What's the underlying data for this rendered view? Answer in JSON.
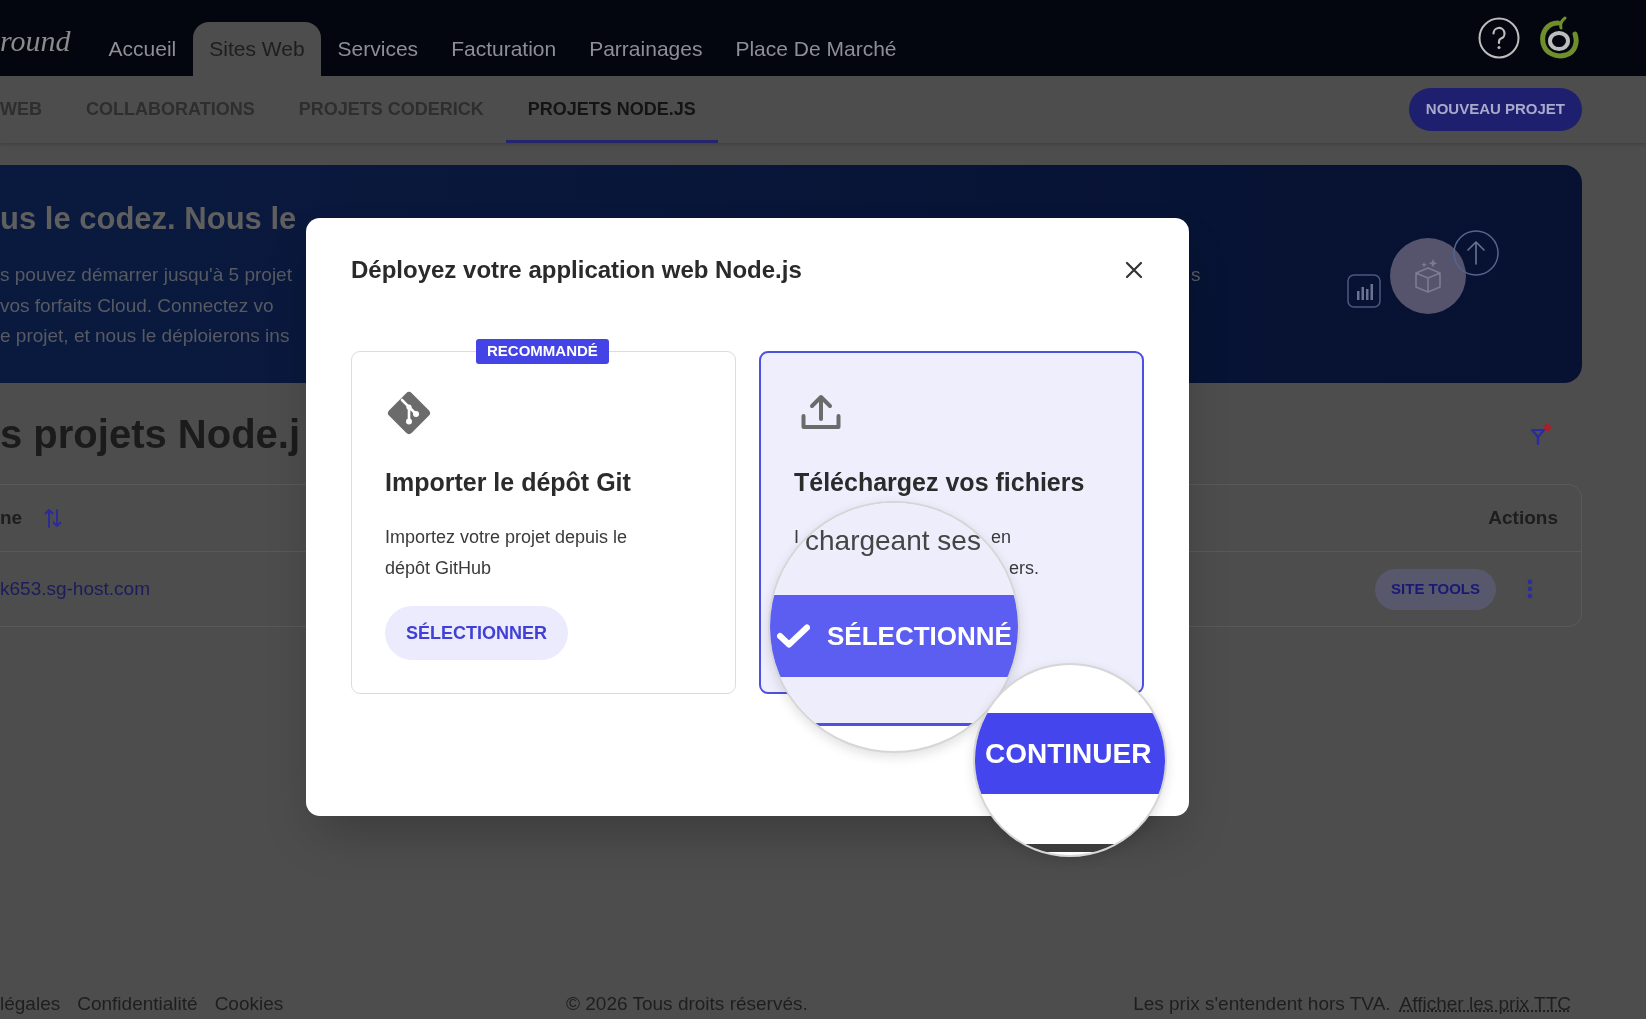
{
  "top_nav": {
    "logo": "round",
    "items": [
      {
        "label": "Accueil",
        "selected": false
      },
      {
        "label": "Sites Web",
        "selected": true
      },
      {
        "label": "Services",
        "selected": false
      },
      {
        "label": "Facturation",
        "selected": false
      },
      {
        "label": "Parrainages",
        "selected": false
      },
      {
        "label": "Place De Marché",
        "selected": false
      }
    ]
  },
  "sub_nav": {
    "tabs": [
      {
        "label": "WEB",
        "selected": false
      },
      {
        "label": "COLLABORATIONS",
        "selected": false
      },
      {
        "label": "PROJETS CODERICK",
        "selected": false
      },
      {
        "label": "PROJETS NODE.JS",
        "selected": true
      }
    ],
    "button": "NOUVEAU PROJET"
  },
  "banner": {
    "title": "us le codez. Nous le",
    "lines": [
      "s pouvez démarrer jusqu'à 5 projet",
      "vos forfaits Cloud. Connectez vo",
      "e projet, et nous le déploierons ins"
    ],
    "line_end": "s"
  },
  "projects": {
    "heading": "s projets Node.j",
    "columns": [
      "ne",
      "Actions"
    ],
    "rows": [
      {
        "link": "k653.sg-host.com",
        "button": "SITE TOOLS"
      }
    ]
  },
  "modal": {
    "title": "Déployez votre application web Node.js",
    "options": [
      {
        "kind": "git",
        "badge": "RECOMMANDÉ",
        "title": "Importer le dépôt Git",
        "description": "Importez votre projet depuis le dépôt GitHub",
        "button": "SÉLECTIONNER",
        "selected": false
      },
      {
        "kind": "upload",
        "title": "Téléchargez vos fichiers",
        "description_lines": [
          [
            "I",
            "en"
          ],
          [
            "ers."
          ]
        ],
        "selected": true
      }
    ],
    "magnifiers": [
      {
        "kind": "selection",
        "text": "chargeant ses",
        "button": "SÉLECTIONNÉ"
      },
      {
        "kind": "continue",
        "button": "CONTINUER"
      }
    ]
  },
  "footer": {
    "links": [
      "légales",
      "Confidentialité",
      "Cookies"
    ],
    "copyright": "© 2026 Tous droits réservés.",
    "price_note": "Les prix s'entendent hors TVA.",
    "price_link": "Afficher les prix TTC"
  }
}
